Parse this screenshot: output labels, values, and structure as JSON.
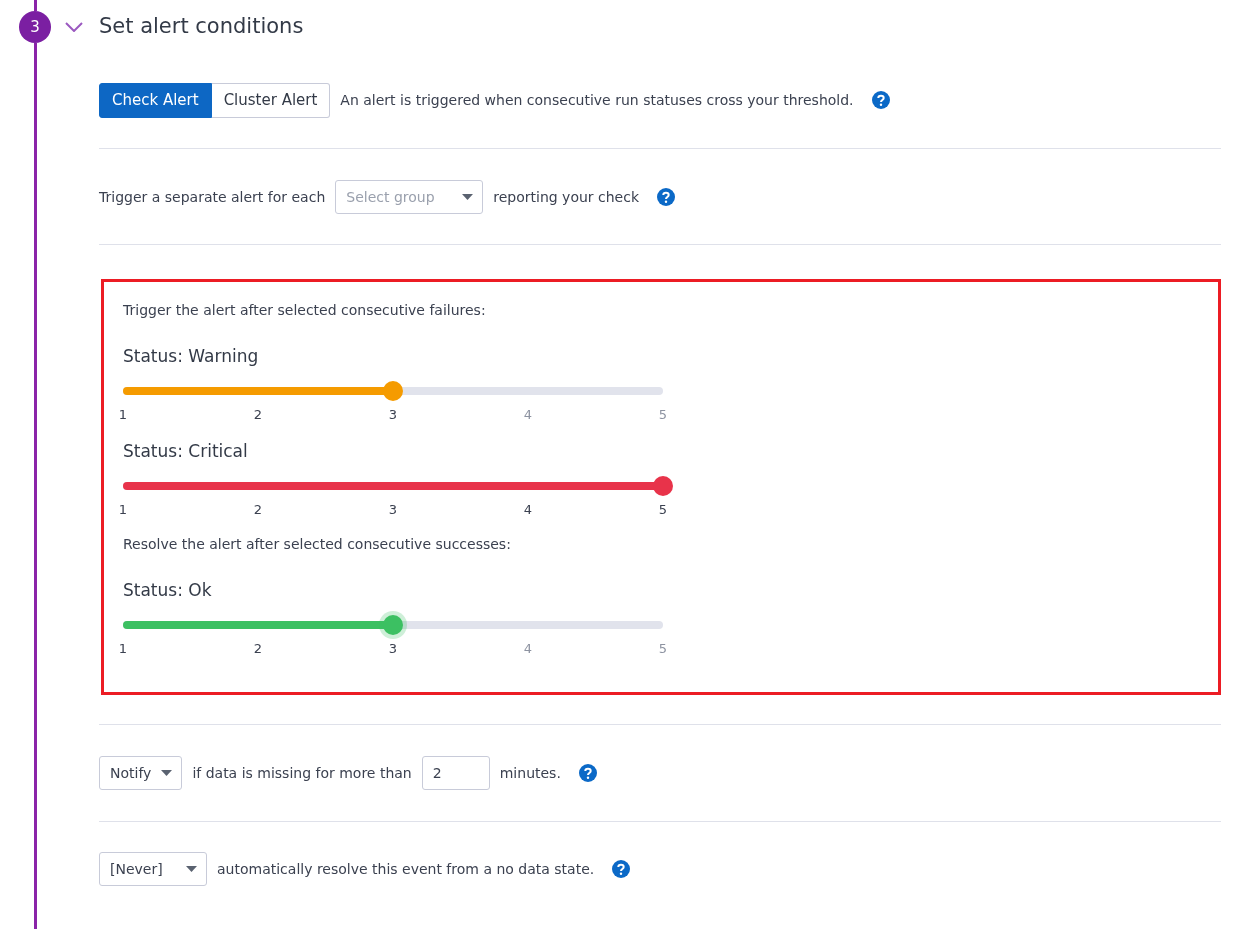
{
  "step": {
    "number": "3",
    "expanded": true,
    "title": "Set alert conditions"
  },
  "alert_type": {
    "options": [
      {
        "label": "Check Alert",
        "selected": true
      },
      {
        "label": "Cluster Alert",
        "selected": false
      }
    ],
    "description": "An alert is triggered when consecutive run statuses cross your threshold."
  },
  "group_row": {
    "prefix": "Trigger a separate alert for each",
    "dropdown": {
      "placeholder": "Select group"
    },
    "suffix": "reporting your check"
  },
  "thresholds": {
    "highlighted": true,
    "items": [
      {
        "kind": "heading",
        "text": "Trigger the alert after selected consecutive failures:"
      },
      {
        "kind": "slider",
        "label": "Status: Warning",
        "level": 0.5,
        "color": "#f59b00",
        "focused": false,
        "ticks": [
          "1",
          "2",
          "3",
          "4",
          "5"
        ]
      },
      {
        "kind": "slider",
        "label": "Status: Critical",
        "level": 1,
        "color": "#e8334a",
        "focused": false,
        "ticks": [
          "1",
          "2",
          "3",
          "4",
          "5"
        ]
      },
      {
        "kind": "heading",
        "text": "Resolve the alert after selected consecutive successes:"
      },
      {
        "kind": "slider",
        "label": "Status: Ok",
        "level": 0.5,
        "color": "#3cc062",
        "focused": true,
        "ticks": [
          "1",
          "2",
          "3",
          "4",
          "5"
        ]
      }
    ]
  },
  "missing_data": {
    "dropdown": "Notify",
    "prefix": "if data is missing for more than",
    "value": "2",
    "suffix": "minutes."
  },
  "auto_resolve": {
    "dropdown": "[Never]",
    "text": "automatically resolve this event from a no data state."
  }
}
